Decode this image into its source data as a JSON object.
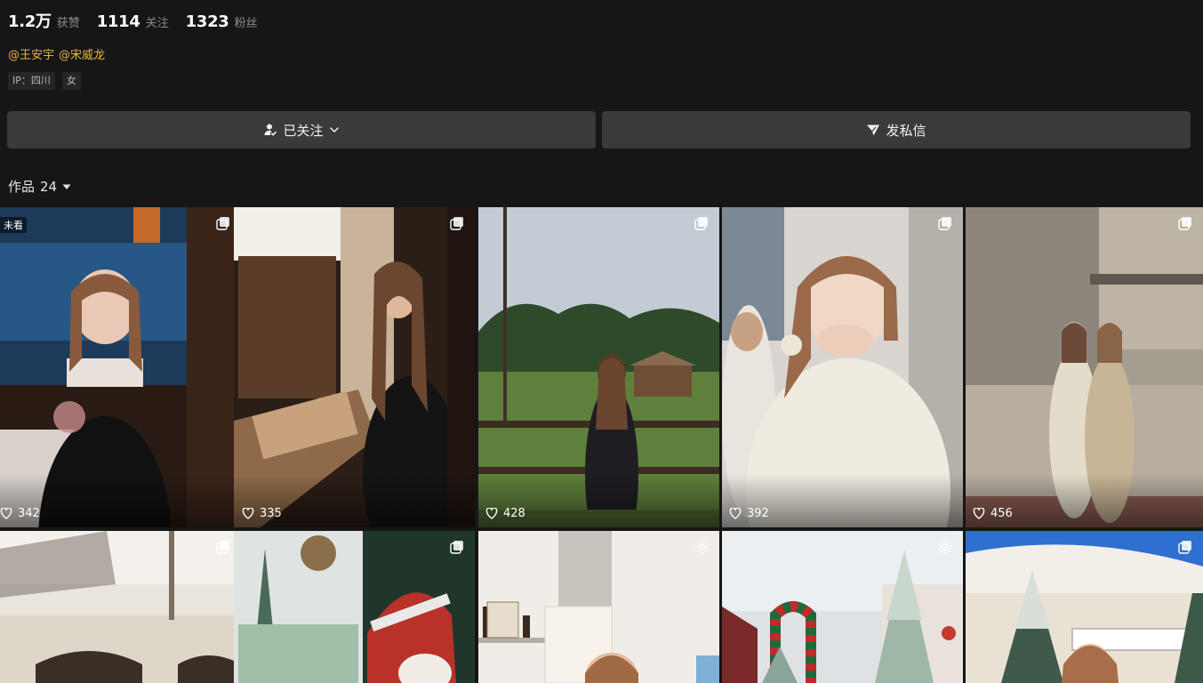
{
  "profile": {
    "stats": [
      {
        "value": "1.2万",
        "label": "获赞"
      },
      {
        "value": "1114",
        "label": "关注"
      },
      {
        "value": "1323",
        "label": "粉丝"
      }
    ],
    "mentions": [
      "@王安宇",
      "@宋威龙"
    ],
    "tags": [
      "IP：四川",
      "女"
    ]
  },
  "actions": {
    "follow_label": "已关注",
    "message_label": "发私信"
  },
  "works": {
    "label": "作品",
    "count": "24"
  },
  "posts": [
    {
      "likes": "342",
      "badge": "multi-image-icon",
      "unseen_label": "未看"
    },
    {
      "likes": "335",
      "badge": "multi-image-icon"
    },
    {
      "likes": "428",
      "badge": "multi-image-icon"
    },
    {
      "likes": "392",
      "badge": "multi-image-icon"
    },
    {
      "likes": "456",
      "badge": "multi-image-icon"
    },
    {
      "likes": "",
      "badge": "multi-image-icon"
    },
    {
      "likes": "",
      "badge": "multi-image-icon"
    },
    {
      "likes": "",
      "badge": "live-photo-icon"
    },
    {
      "likes": "",
      "badge": "live-photo-icon"
    },
    {
      "likes": "",
      "badge": "multi-image-icon"
    }
  ],
  "colors": {
    "background": "#161616",
    "button": "#3a3a3a",
    "mention": "#e9b43f",
    "muted": "#8c8c8c"
  }
}
